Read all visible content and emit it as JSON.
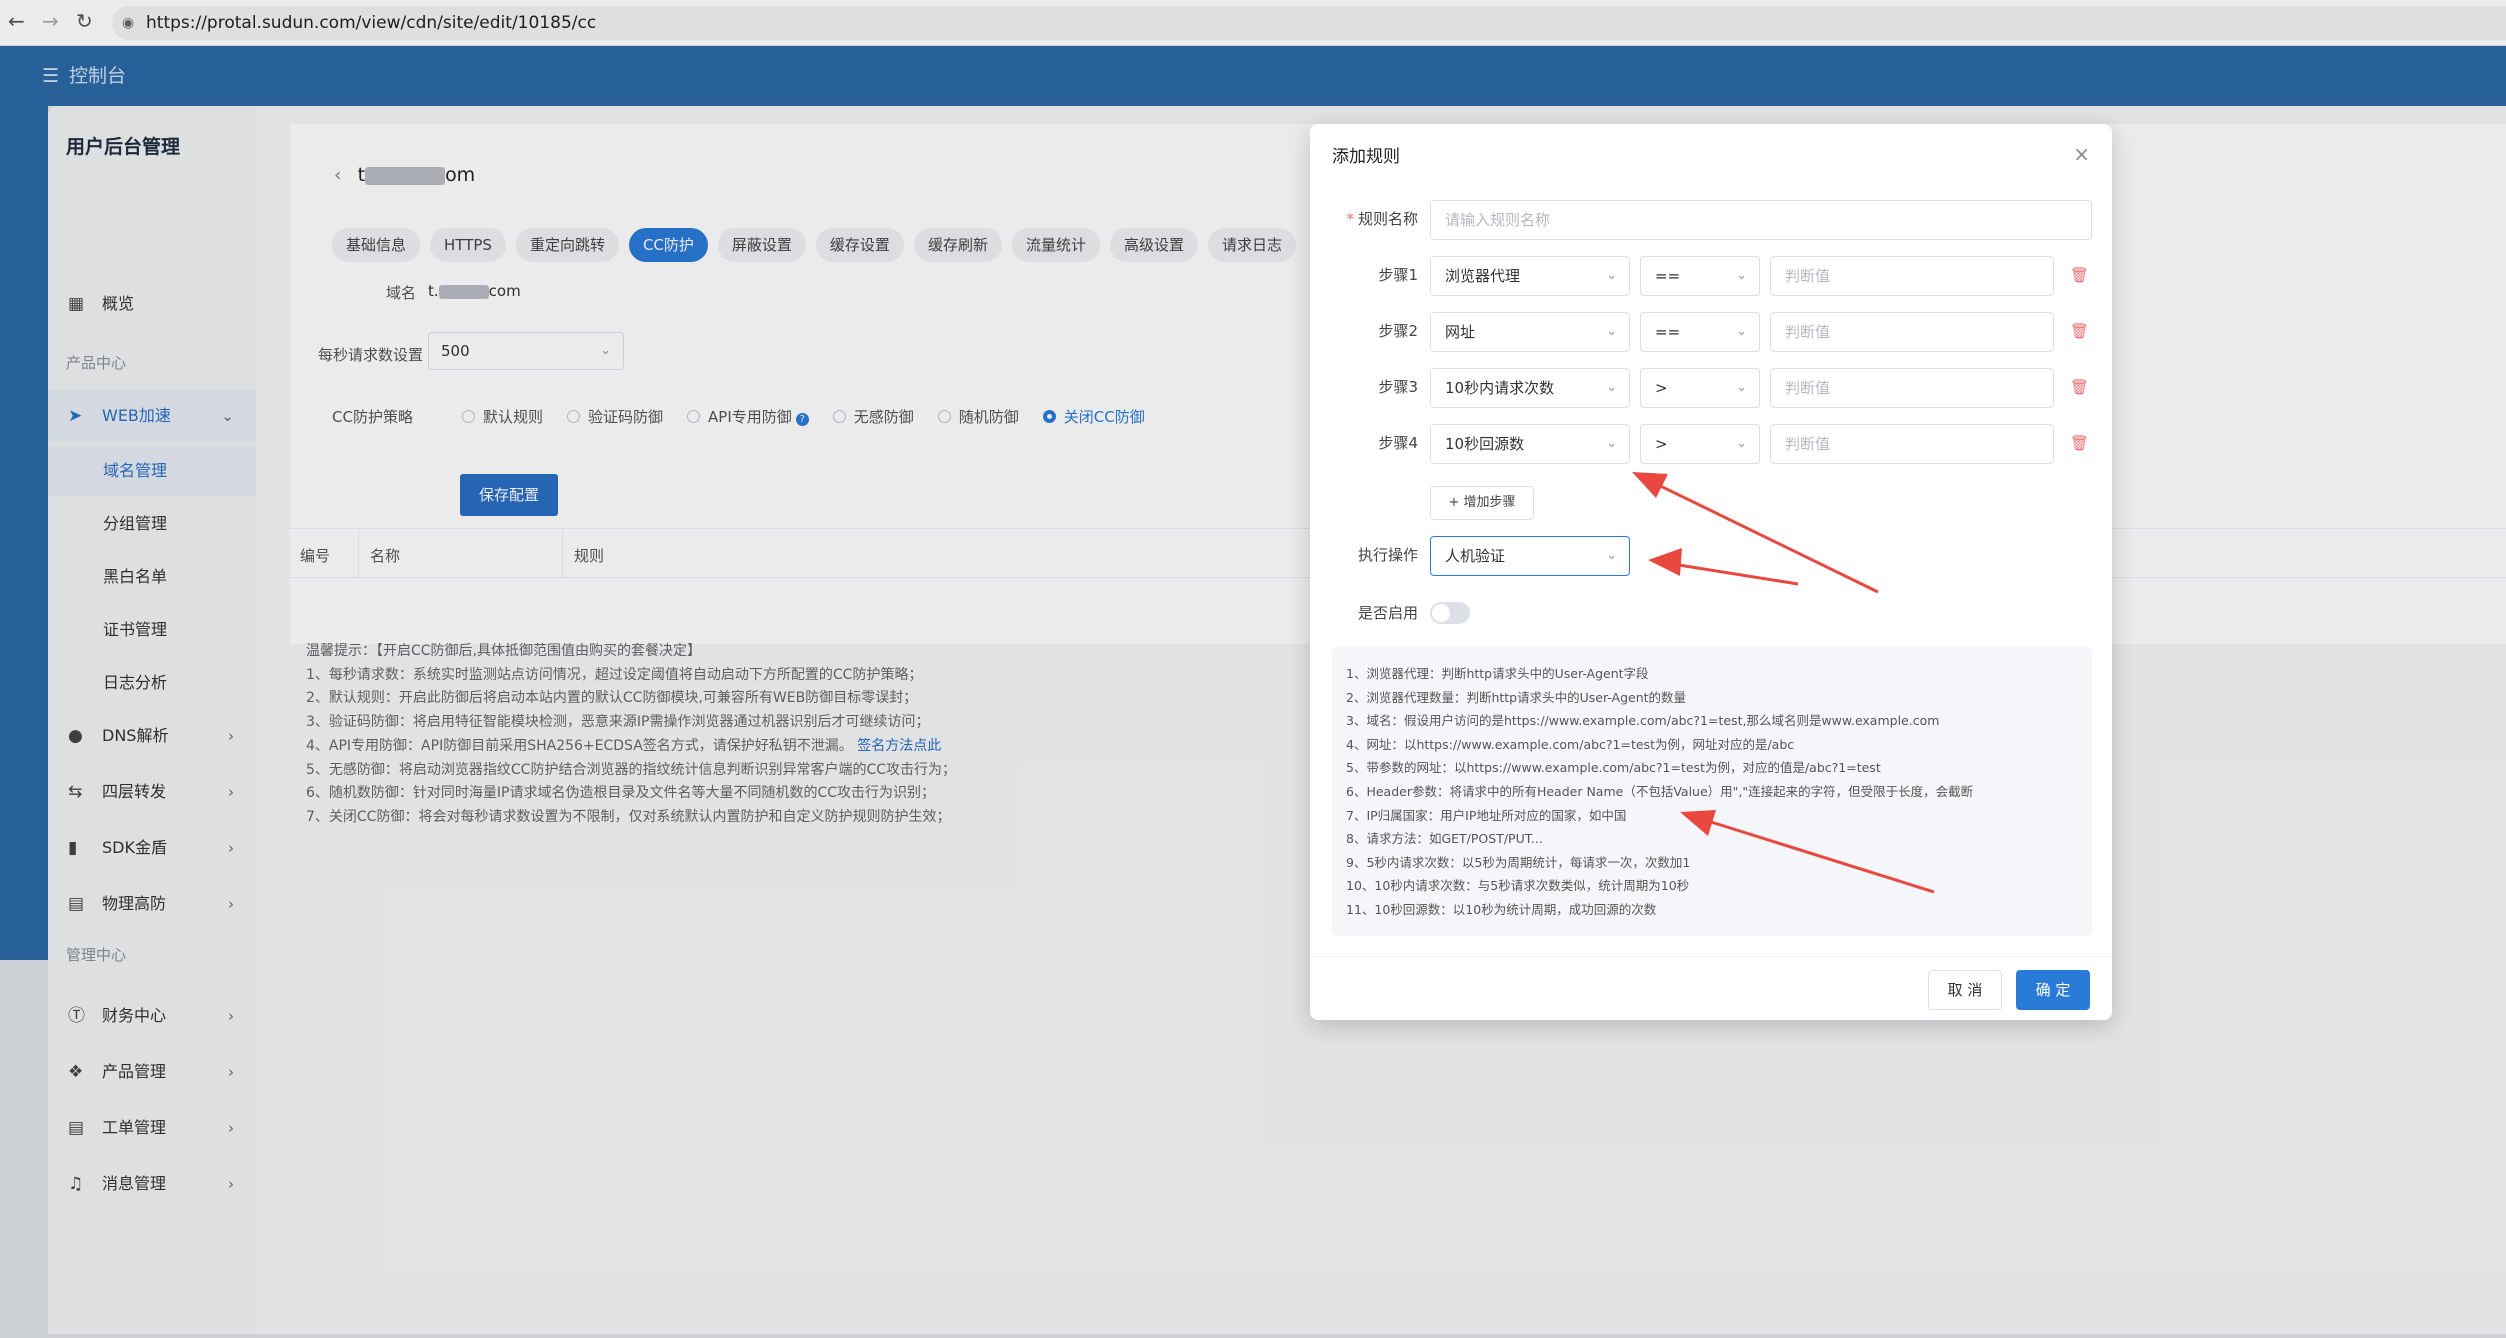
{
  "browser": {
    "url": "https://protal.sudun.com/view/cdn/site/edit/10185/cc"
  },
  "topbar": {
    "brand": "控制台"
  },
  "sidebar": {
    "title": "用户后台管理",
    "overview": "概览",
    "section_products": "产品中心",
    "web": "WEB加速",
    "subs": [
      "域名管理",
      "分组管理",
      "黑白名单",
      "证书管理",
      "日志分析"
    ],
    "dns": "DNS解析",
    "l4": "四层转发",
    "sdk": "SDK金盾",
    "phys": "物理高防",
    "section_manage": "管理中心",
    "finance": "财务中心",
    "product_mgmt": "产品管理",
    "ticket": "工单管理",
    "message": "消息管理"
  },
  "page": {
    "crumb_prefix": "t",
    "crumb_suffix": "om",
    "tabs": [
      "基础信息",
      "HTTPS",
      "重定向跳转",
      "CC防护",
      "屏蔽设置",
      "缓存设置",
      "缓存刷新",
      "流量统计",
      "高级设置",
      "请求日志"
    ],
    "domain_label": "域名",
    "domain_prefix": "t.",
    "domain_suffix": "com",
    "rps_label": "每秒请求数设置",
    "rps_value": "500",
    "strategy_label": "CC防护策略",
    "strategies": [
      "默认规则",
      "验证码防御",
      "API专用防御",
      "无感防御",
      "随机防御",
      "关闭CC防御"
    ],
    "save_button": "保存配置",
    "table_headers": [
      "编号",
      "名称",
      "规则"
    ],
    "tips": [
      "温馨提示：【开启CC防御后,具体抵御范围值由购买的套餐决定】",
      "1、每秒请求数：系统实时监测站点访问情况，超过设定阈值将自动启动下方所配置的CC防护策略；",
      "2、默认规则：开启此防御后将启动本站内置的默认CC防御模块,可兼容所有WEB防御目标零误封；",
      "3、验证码防御：将启用特征智能模块检测，恶意来源IP需操作浏览器通过机器识别后才可继续访问；",
      "4、API专用防御：API防御目前采用SHA256+ECDSA签名方式，请保护好私钥不泄漏。",
      "5、无感防御：将启动浏览器指纹CC防护结合浏览器的指纹统计信息判断识别异常客户端的CC攻击行为；",
      "6、随机数防御：针对同时海量IP请求域名伪造根目录及文件名等大量不同随机数的CC攻击行为识别；",
      "7、关闭CC防御：将会对每秒请求数设置为不限制，仅对系统默认内置防护和自定义防护规则防护生效；"
    ],
    "tips_link": "签名方法点此"
  },
  "modal": {
    "title": "添加规则",
    "rule_name_label": "规则名称",
    "rule_name_placeholder": "请输入规则名称",
    "steps": [
      {
        "label": "步骤1",
        "field": "浏览器代理",
        "op": "==",
        "placeholder": "判断值"
      },
      {
        "label": "步骤2",
        "field": "网址",
        "op": "==",
        "placeholder": "判断值"
      },
      {
        "label": "步骤3",
        "field": "10秒内请求次数",
        "op": ">",
        "placeholder": "判断值"
      },
      {
        "label": "步骤4",
        "field": "10秒回源数",
        "op": ">",
        "placeholder": "判断值"
      }
    ],
    "add_step": "增加步骤",
    "action_label": "执行操作",
    "action_value": "人机验证",
    "enable_label": "是否启用",
    "notes": [
      "1、浏览器代理：判断http请求头中的User-Agent字段",
      "2、浏览器代理数量：判断http请求头中的User-Agent的数量",
      "3、域名：假设用户访问的是https://www.example.com/abc?1=test,那么域名则是www.example.com",
      "4、网址：以https://www.example.com/abc?1=test为例，网址对应的是/abc",
      "5、带参数的网址：以https://www.example.com/abc?1=test为例，对应的值是/abc?1=test",
      "6、Header参数：将请求中的所有Header Name（不包括Value）用\",\"连接起来的字符，但受限于长度，会截断",
      "7、IP归属国家：用户IP地址所对应的国家，如中国",
      "8、请求方法：如GET/POST/PUT...",
      "9、5秒内请求次数：以5秒为周期统计，每请求一次，次数加1",
      "10、10秒内请求次数：与5秒请求次数类似，统计周期为10秒",
      "11、10秒回源数：以10秒为统计周期，成功回源的次数"
    ],
    "cancel": "取 消",
    "confirm": "确 定"
  },
  "colors": {
    "primary": "#2a7ad8",
    "topbar": "#2c6aa6",
    "danger": "#f56c6c",
    "arrow": "#e8483f"
  }
}
